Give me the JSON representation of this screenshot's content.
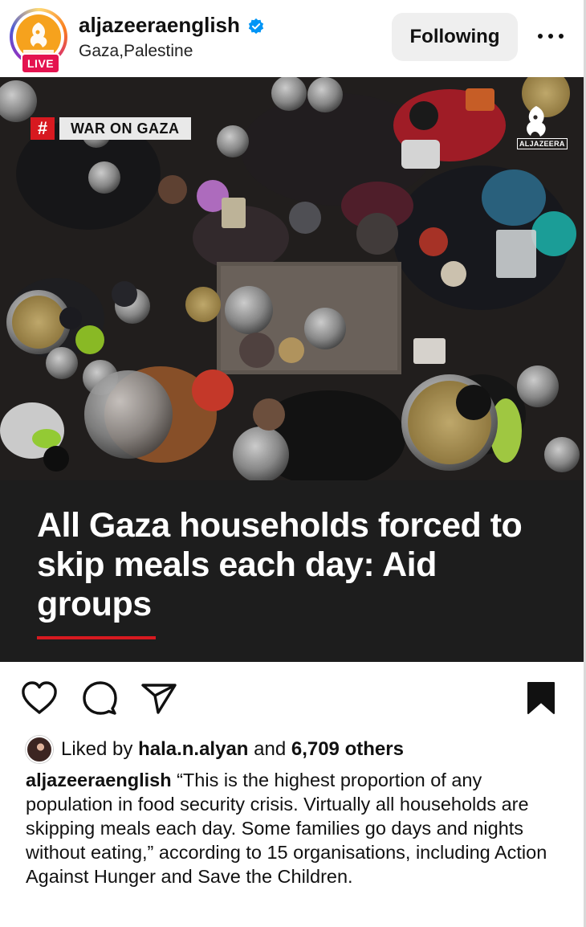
{
  "post": {
    "username": "aljazeeraenglish",
    "location": "Gaza,Palestine",
    "live_label": "LIVE",
    "follow_label": "Following",
    "avatar_text": "ALJAZEERA"
  },
  "image": {
    "tag_hash": "#",
    "tag_label": "WAR ON GAZA",
    "watermark": "ALJAZEERA",
    "headline": "All Gaza households forced to skip meals each day: Aid groups"
  },
  "likes": {
    "prefix": "Liked by",
    "user": "hala.n.alyan",
    "middle": "and",
    "others": "6,709 others"
  },
  "caption": {
    "user": "aljazeeraenglish",
    "text": "“This is the highest proportion of any population in food security crisis. Virtually all households are skipping meals each day. Some families go days and nights without eating,” according to 15 organisations, including Action Against Hunger and Save the Children."
  },
  "icons": {
    "like": "heart-icon",
    "comment": "comment-icon",
    "share": "send-icon",
    "save": "bookmark-icon",
    "verified": "verified-badge-icon",
    "more": "more-options-icon"
  },
  "colors": {
    "accent_red": "#d71920",
    "live_badge": "#e4134f",
    "verified_blue": "#0095f6",
    "headline_bg": "#1d1d1d",
    "logo_orange": "#f6a21d"
  }
}
